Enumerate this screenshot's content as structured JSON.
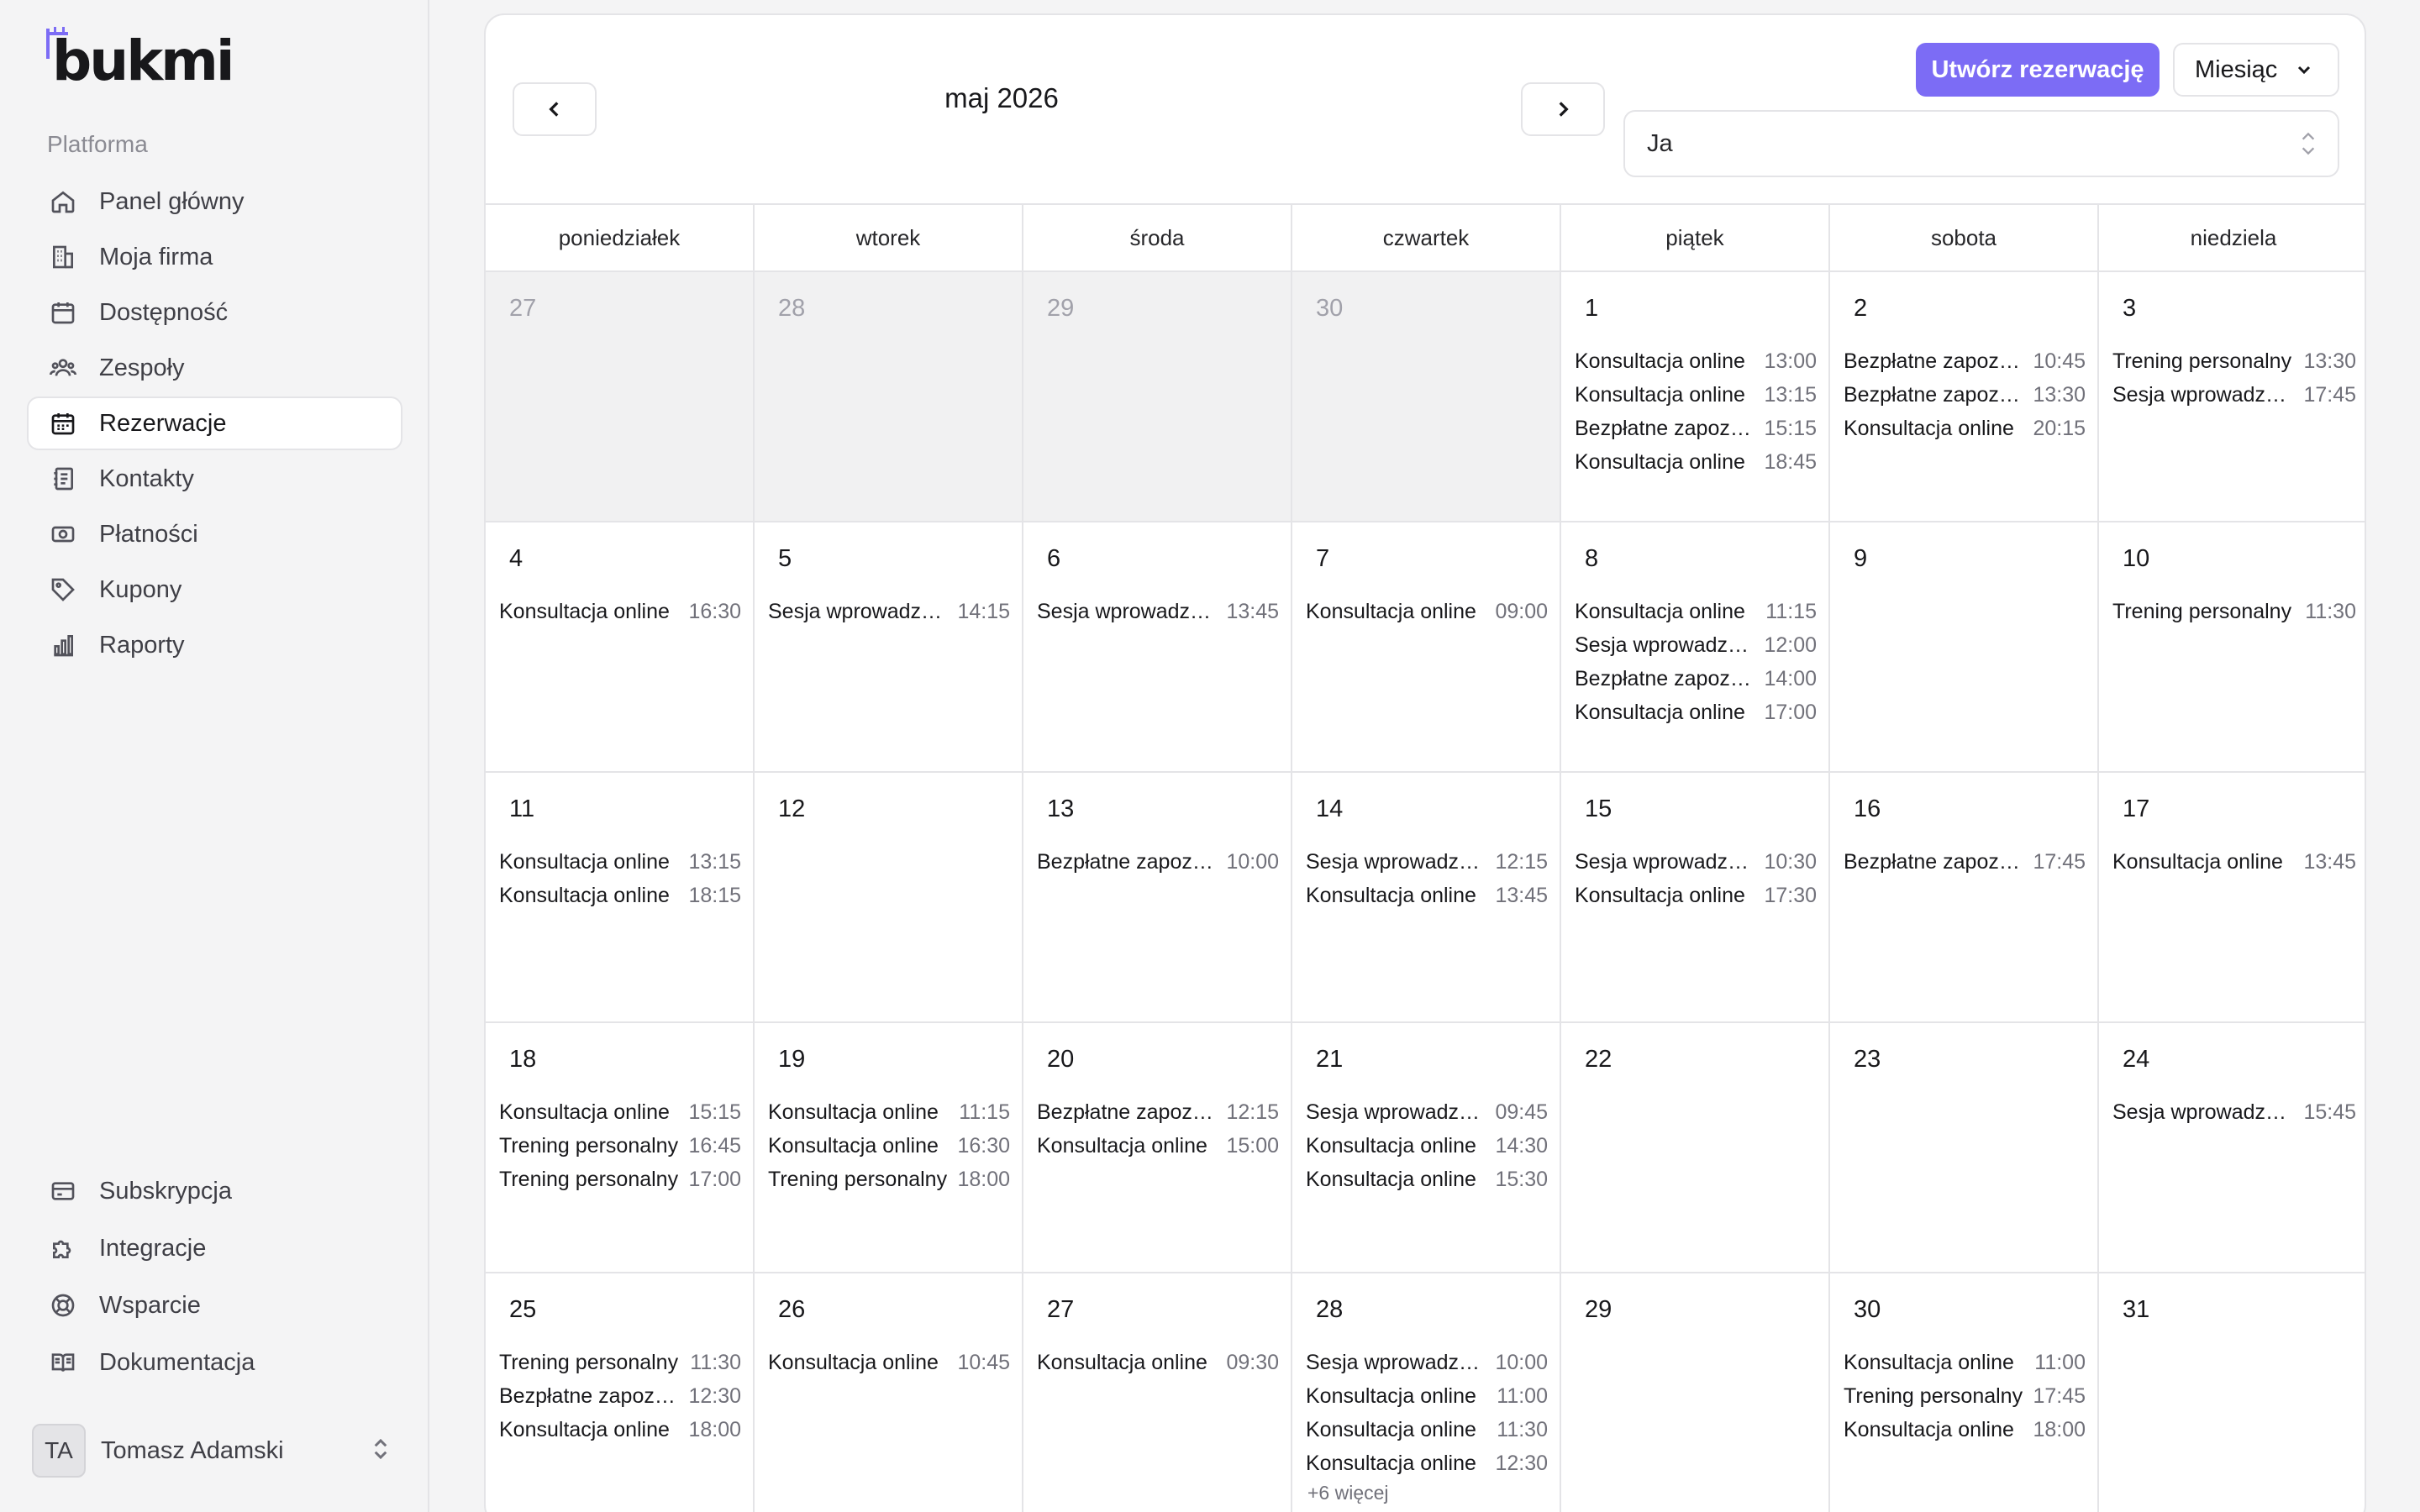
{
  "app": {
    "logo_text": "bukmi"
  },
  "sidebar": {
    "section_label": "Platforma",
    "items": [
      {
        "label": "Panel główny",
        "icon": "home-icon"
      },
      {
        "label": "Moja firma",
        "icon": "building-icon"
      },
      {
        "label": "Dostępność",
        "icon": "calendar-icon"
      },
      {
        "label": "Zespoły",
        "icon": "users-icon"
      },
      {
        "label": "Rezerwacje",
        "icon": "calendar-grid-icon",
        "active": true
      },
      {
        "label": "Kontakty",
        "icon": "contacts-icon"
      },
      {
        "label": "Płatności",
        "icon": "money-icon"
      },
      {
        "label": "Kupony",
        "icon": "tag-icon"
      },
      {
        "label": "Raporty",
        "icon": "bar-chart-icon"
      }
    ],
    "bottom_items": [
      {
        "label": "Subskrypcja",
        "icon": "credit-card-icon"
      },
      {
        "label": "Integracje",
        "icon": "puzzle-icon"
      },
      {
        "label": "Wsparcie",
        "icon": "lifebuoy-icon"
      },
      {
        "label": "Dokumentacja",
        "icon": "book-icon"
      }
    ],
    "user": {
      "initials": "TA",
      "name": "Tomasz Adamski"
    }
  },
  "toolbar": {
    "month_title": "maj 2026",
    "create_label": "Utwórz rezerwację",
    "view_label": "Miesiąc",
    "person_value": "Ja"
  },
  "calendar": {
    "weekdays": [
      "poniedziałek",
      "wtorek",
      "środa",
      "czwartek",
      "piątek",
      "sobota",
      "niedziela"
    ],
    "days": [
      {
        "num": "27",
        "muted": true,
        "events": []
      },
      {
        "num": "28",
        "muted": true,
        "events": []
      },
      {
        "num": "29",
        "muted": true,
        "events": []
      },
      {
        "num": "30",
        "muted": true,
        "events": []
      },
      {
        "num": "1",
        "events": [
          {
            "title": "Konsultacja online",
            "time": "13:00"
          },
          {
            "title": "Konsultacja online",
            "time": "13:15"
          },
          {
            "title": "Bezpłatne zapoznanie",
            "time": "15:15"
          },
          {
            "title": "Konsultacja online",
            "time": "18:45"
          }
        ]
      },
      {
        "num": "2",
        "events": [
          {
            "title": "Bezpłatne zapoznanie",
            "time": "10:45"
          },
          {
            "title": "Bezpłatne zapoznanie",
            "time": "13:30"
          },
          {
            "title": "Konsultacja online",
            "time": "20:15"
          }
        ]
      },
      {
        "num": "3",
        "events": [
          {
            "title": "Trening personalny",
            "time": "13:30"
          },
          {
            "title": "Sesja wprowadzająca",
            "time": "17:45"
          }
        ]
      },
      {
        "num": "4",
        "events": [
          {
            "title": "Konsultacja online",
            "time": "16:30"
          }
        ]
      },
      {
        "num": "5",
        "events": [
          {
            "title": "Sesja wprowadzająca",
            "time": "14:15"
          }
        ]
      },
      {
        "num": "6",
        "events": [
          {
            "title": "Sesja wprowadzająca",
            "time": "13:45"
          }
        ]
      },
      {
        "num": "7",
        "events": [
          {
            "title": "Konsultacja online",
            "time": "09:00"
          }
        ]
      },
      {
        "num": "8",
        "events": [
          {
            "title": "Konsultacja online",
            "time": "11:15"
          },
          {
            "title": "Sesja wprowadzająca",
            "time": "12:00"
          },
          {
            "title": "Bezpłatne zapoznanie",
            "time": "14:00"
          },
          {
            "title": "Konsultacja online",
            "time": "17:00"
          }
        ]
      },
      {
        "num": "9",
        "events": []
      },
      {
        "num": "10",
        "events": [
          {
            "title": "Trening personalny",
            "time": "11:30"
          }
        ]
      },
      {
        "num": "11",
        "events": [
          {
            "title": "Konsultacja online",
            "time": "13:15"
          },
          {
            "title": "Konsultacja online",
            "time": "18:15"
          }
        ]
      },
      {
        "num": "12",
        "events": []
      },
      {
        "num": "13",
        "events": [
          {
            "title": "Bezpłatne zapoznanie",
            "time": "10:00"
          }
        ]
      },
      {
        "num": "14",
        "events": [
          {
            "title": "Sesja wprowadzająca",
            "time": "12:15"
          },
          {
            "title": "Konsultacja online",
            "time": "13:45"
          }
        ]
      },
      {
        "num": "15",
        "events": [
          {
            "title": "Sesja wprowadzająca",
            "time": "10:30"
          },
          {
            "title": "Konsultacja online",
            "time": "17:30"
          }
        ]
      },
      {
        "num": "16",
        "events": [
          {
            "title": "Bezpłatne zapoznanie",
            "time": "17:45"
          }
        ]
      },
      {
        "num": "17",
        "events": [
          {
            "title": "Konsultacja online",
            "time": "13:45"
          }
        ]
      },
      {
        "num": "18",
        "events": [
          {
            "title": "Konsultacja online",
            "time": "15:15"
          },
          {
            "title": "Trening personalny",
            "time": "16:45"
          },
          {
            "title": "Trening personalny",
            "time": "17:00"
          }
        ]
      },
      {
        "num": "19",
        "events": [
          {
            "title": "Konsultacja online",
            "time": "11:15"
          },
          {
            "title": "Konsultacja online",
            "time": "16:30"
          },
          {
            "title": "Trening personalny",
            "time": "18:00"
          }
        ]
      },
      {
        "num": "20",
        "events": [
          {
            "title": "Bezpłatne zapoznanie",
            "time": "12:15"
          },
          {
            "title": "Konsultacja online",
            "time": "15:00"
          }
        ]
      },
      {
        "num": "21",
        "events": [
          {
            "title": "Sesja wprowadzająca",
            "time": "09:45"
          },
          {
            "title": "Konsultacja online",
            "time": "14:30"
          },
          {
            "title": "Konsultacja online",
            "time": "15:30"
          }
        ]
      },
      {
        "num": "22",
        "events": []
      },
      {
        "num": "23",
        "events": []
      },
      {
        "num": "24",
        "events": [
          {
            "title": "Sesja wprowadzająca",
            "time": "15:45"
          }
        ]
      },
      {
        "num": "25",
        "events": [
          {
            "title": "Trening personalny",
            "time": "11:30"
          },
          {
            "title": "Bezpłatne zapoznanie",
            "time": "12:30"
          },
          {
            "title": "Konsultacja online",
            "time": "18:00"
          }
        ]
      },
      {
        "num": "26",
        "events": [
          {
            "title": "Konsultacja online",
            "time": "10:45"
          }
        ]
      },
      {
        "num": "27",
        "events": [
          {
            "title": "Konsultacja online",
            "time": "09:30"
          }
        ]
      },
      {
        "num": "28",
        "more": "+6 więcej",
        "events": [
          {
            "title": "Sesja wprowadzająca",
            "time": "10:00"
          },
          {
            "title": "Konsultacja online",
            "time": "11:00"
          },
          {
            "title": "Konsultacja online",
            "time": "11:30"
          },
          {
            "title": "Konsultacja online",
            "time": "12:30"
          }
        ]
      },
      {
        "num": "29",
        "events": []
      },
      {
        "num": "30",
        "events": [
          {
            "title": "Konsultacja online",
            "time": "11:00"
          },
          {
            "title": "Trening personalny",
            "time": "17:45"
          },
          {
            "title": "Konsultacja online",
            "time": "18:00"
          }
        ]
      },
      {
        "num": "31",
        "events": []
      }
    ]
  },
  "colors": {
    "accent": "#7c6cf5",
    "logo_mark": "#7c6cf5"
  }
}
